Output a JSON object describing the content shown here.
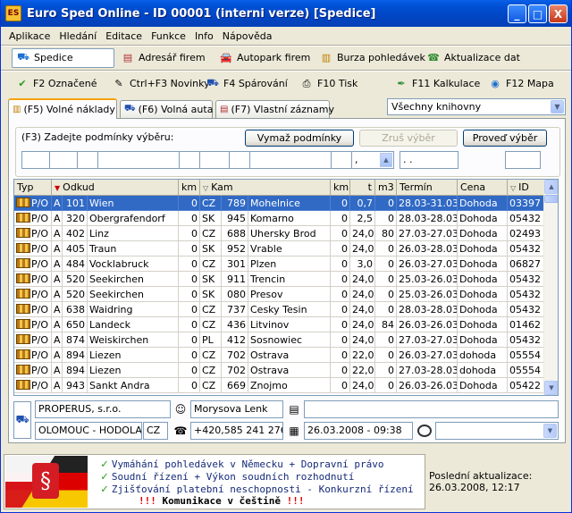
{
  "window": {
    "title": "Euro Sped Online - ID 00001 (interni verze) [Spedice]",
    "controls": [
      "_",
      "□",
      "X"
    ]
  },
  "menu": [
    "Aplikace",
    "Hledání",
    "Editace",
    "Funkce",
    "Info",
    "Nápověda"
  ],
  "toolbar1": [
    {
      "label": "Spedice",
      "icon": "truck-check-icon"
    },
    {
      "label": "Adresář firem",
      "icon": "address-book-icon"
    },
    {
      "label": "Autopark firem",
      "icon": "car-icon"
    },
    {
      "label": "Burza pohledávek",
      "icon": "stack-icon"
    },
    {
      "label": "Aktualizace dat",
      "icon": "phone-icon"
    }
  ],
  "toolbar2": [
    {
      "label": "F2 Označené",
      "icon": "checkmark-icon"
    },
    {
      "label": "Ctrl+F3 Novinky",
      "icon": "news-icon"
    },
    {
      "label": "F4 Spárování",
      "icon": "pair-icon"
    },
    {
      "label": "F10 Tisk",
      "icon": "printer-icon"
    },
    {
      "label": "F11 Kalkulace",
      "icon": "pen-icon"
    },
    {
      "label": "F12 Mapa",
      "icon": "globe-icon"
    }
  ],
  "tabs": [
    {
      "label": "(F5) Volné náklady",
      "active": true
    },
    {
      "label": "(F6) Volná auta",
      "active": false
    },
    {
      "label": "(F7) Vlastní záznamy",
      "active": false
    }
  ],
  "library_select": "Všechny knihovny",
  "filter": {
    "label": "(F3) Zadejte podmínky výběru:",
    "clear_button": "Vymaž podmínky",
    "undo_button": "Zruš výběr",
    "apply_button": "Proveď výběr",
    "comma_field": ",",
    "dots_field": ". ."
  },
  "grid": {
    "headers": [
      "Typ",
      "Odkud",
      "km",
      "Kam",
      "km",
      "t",
      "m3",
      "Termín",
      "Cena",
      "ID"
    ],
    "rows": [
      [
        "P/O",
        "A",
        "101",
        "Wien",
        "0",
        "CZ",
        "789",
        "Mohelnice",
        "0",
        "0,7",
        "0",
        "28.03-31.03",
        "Dohoda",
        "03397"
      ],
      [
        "P/O",
        "A",
        "320",
        "Obergrafendorf",
        "0",
        "SK",
        "945",
        "Komarno",
        "0",
        "2,5",
        "0",
        "28.03-28.03",
        "Dohoda",
        "05432"
      ],
      [
        "P/O",
        "A",
        "402",
        "Linz",
        "0",
        "CZ",
        "688",
        "Uhersky Brod",
        "0",
        "24,0",
        "80",
        "27.03-27.03",
        "Dohoda",
        "02493"
      ],
      [
        "P/O",
        "A",
        "405",
        "Traun",
        "0",
        "SK",
        "952",
        "Vrable",
        "0",
        "24,0",
        "0",
        "26.03-28.03",
        "Dohoda",
        "05432"
      ],
      [
        "P/O",
        "A",
        "484",
        "Vocklabruck",
        "0",
        "CZ",
        "301",
        "Plzen",
        "0",
        "3,0",
        "0",
        "26.03-27.03",
        "Dohoda",
        "06827"
      ],
      [
        "P/O",
        "A",
        "520",
        "Seekirchen",
        "0",
        "SK",
        "911",
        "Trencin",
        "0",
        "24,0",
        "0",
        "25.03-26.03",
        "Dohoda",
        "05432"
      ],
      [
        "P/O",
        "A",
        "520",
        "Seekirchen",
        "0",
        "SK",
        "080",
        "Presov",
        "0",
        "24,0",
        "0",
        "25.03-26.03",
        "Dohoda",
        "05432"
      ],
      [
        "P/O",
        "A",
        "638",
        "Waidring",
        "0",
        "CZ",
        "737",
        "Cesky Tesin",
        "0",
        "24,0",
        "0",
        "28.03-28.03",
        "Dohoda",
        "05432"
      ],
      [
        "P/O",
        "A",
        "650",
        "Landeck",
        "0",
        "CZ",
        "436",
        "Litvinov",
        "0",
        "24,0",
        "84",
        "26.03-26.03",
        "Dohoda",
        "01462"
      ],
      [
        "P/O",
        "A",
        "874",
        "Weiskirchen",
        "0",
        "PL",
        "412",
        "Sosnowiec",
        "0",
        "24,0",
        "0",
        "27.03-27.03",
        "Dohoda",
        "05432"
      ],
      [
        "P/O",
        "A",
        "894",
        "Liezen",
        "0",
        "CZ",
        "702",
        "Ostrava",
        "0",
        "22,0",
        "0",
        "26.03-27.03",
        "dohoda",
        "05554"
      ],
      [
        "P/O",
        "A",
        "894",
        "Liezen",
        "0",
        "CZ",
        "702",
        "Ostrava",
        "0",
        "22,0",
        "0",
        "27.03-28.03",
        "dohoda",
        "05554"
      ],
      [
        "P/O",
        "A",
        "943",
        "Sankt Andra",
        "0",
        "CZ",
        "669",
        "Znojmo",
        "0",
        "24,0",
        "0",
        "26.03-26.03",
        "Dohoda",
        "05422"
      ]
    ]
  },
  "detail": {
    "company": "PROPERUS, s.r.o.",
    "contact": "Morysova Lenk",
    "note": "",
    "city": "OLOMOUC - HODOLA",
    "country": "CZ",
    "phone": "+420,585 241 276",
    "date": "26.03.2008 - 09:38",
    "combo": ""
  },
  "banner": {
    "line1": "Vymáhání pohledávek v Německu + Dopravní právo",
    "line2": "Soudní řízení + Výkon soudních rozhodnutí",
    "line3": "Zjišťování platební neschopnosti - Konkurzní řízení",
    "line4": "Komunikace v češtině",
    "excl": "!!!",
    "symbol": "§"
  },
  "update": {
    "label": "Poslední aktualizace:",
    "value": "26.03.2008, 12:17"
  }
}
